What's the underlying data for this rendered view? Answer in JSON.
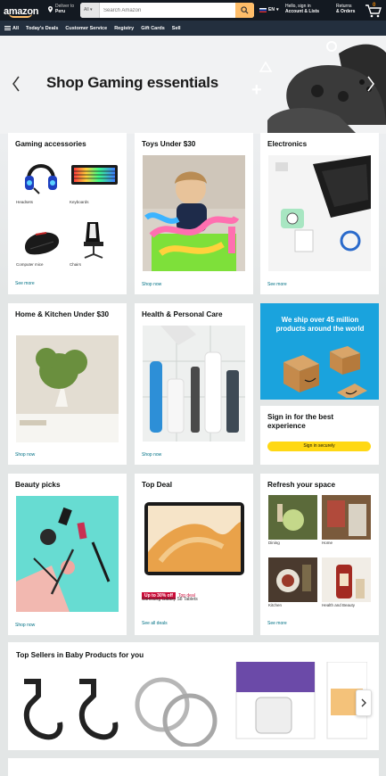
{
  "header": {
    "logo": "amazon",
    "deliver_line1": "Deliver to",
    "deliver_line2": "Peru",
    "search_category": "All",
    "search_placeholder": "Search Amazon",
    "language": "EN",
    "account_line1": "Hello, sign in",
    "account_line2": "Account & Lists",
    "orders_line1": "Returns",
    "orders_line2": "& Orders",
    "cart_count": "0"
  },
  "nav": {
    "all_label": "All",
    "items": [
      "Today's Deals",
      "Customer Service",
      "Registry",
      "Gift Cards",
      "Sell"
    ]
  },
  "hero": {
    "title": "Shop Gaming essentials"
  },
  "cards": {
    "gaming": {
      "title": "Gaming accessories",
      "items": [
        "Headsets",
        "Keyboards",
        "Computer mice",
        "Chairs"
      ],
      "link": "See more"
    },
    "toys": {
      "title": "Toys Under $30",
      "link": "Shop now"
    },
    "electronics": {
      "title": "Electronics",
      "link": "See more"
    },
    "home": {
      "title": "Home & Kitchen Under $30",
      "link": "Shop now"
    },
    "health": {
      "title": "Health & Personal Care",
      "link": "Shop now"
    },
    "promo": {
      "text": "We ship over 45 million products around the world"
    },
    "signin": {
      "title": "Sign in for the best experience",
      "button": "Sign in securely"
    },
    "beauty": {
      "title": "Beauty picks",
      "link": "Shop now"
    },
    "deal": {
      "title": "Top Deal",
      "badge": "Up to 30% off",
      "badge_label": "Top deal",
      "product": "Samsung Galaxy S8 Tablets",
      "link": "See all deals"
    },
    "refresh": {
      "title": "Refresh your space",
      "items": [
        "Dining",
        "Home",
        "Kitchen",
        "Health and Beauty"
      ],
      "link": "See more"
    }
  },
  "strip": {
    "title": "Top Sellers in Baby Products for you"
  },
  "colors": {
    "header_bg": "#131921",
    "nav_bg": "#232f3e",
    "search_button": "#febd69",
    "link": "#007185",
    "signin_button": "#ffd814",
    "promo_bg": "#1aa3dd",
    "deal_badge": "#cc0c39"
  }
}
